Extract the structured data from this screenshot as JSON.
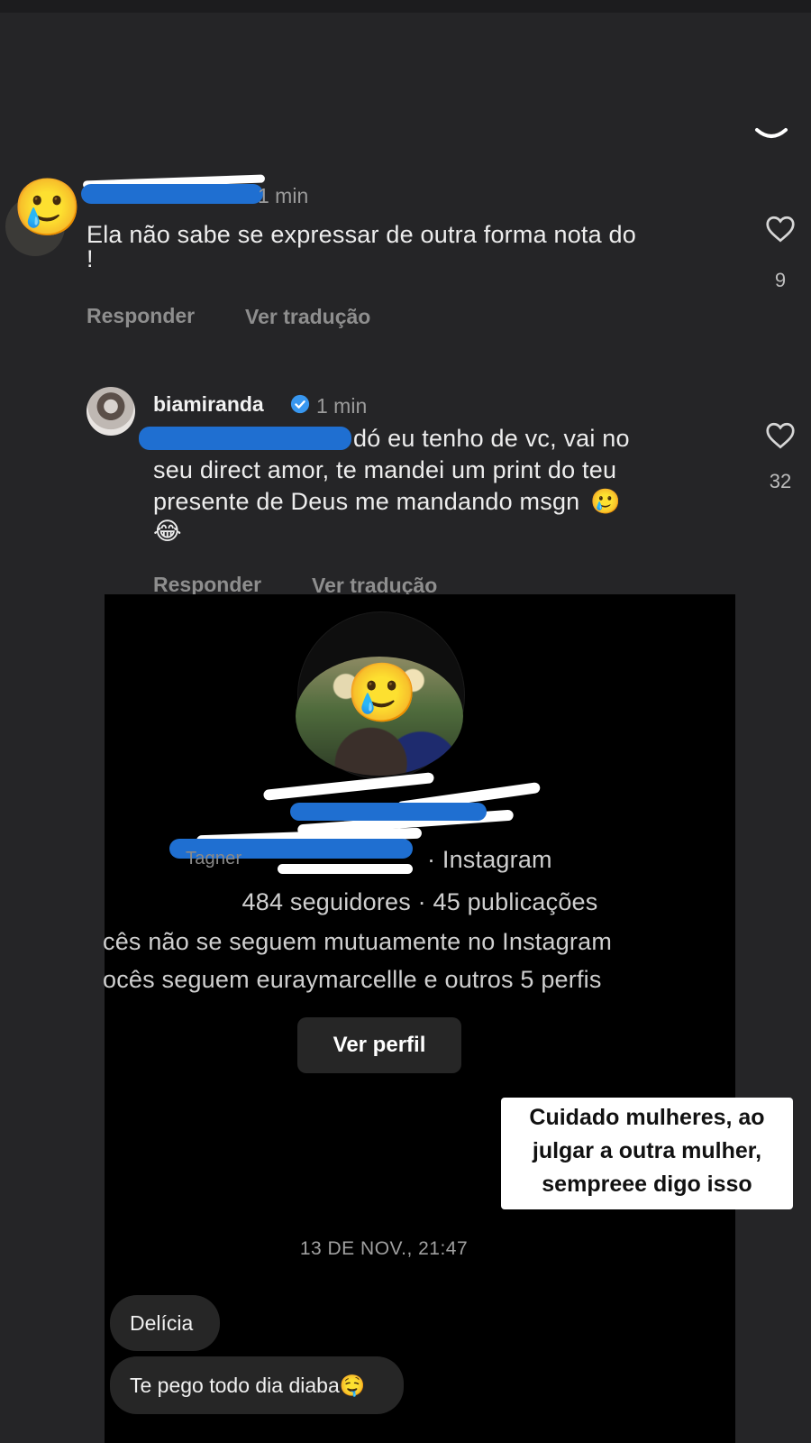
{
  "comment1": {
    "time": "1 min",
    "text_line1": "Ela não sabe se expressar de outra forma nota do",
    "text_line2": "!",
    "likes": "9",
    "reply": "Responder",
    "translate": "Ver tradução"
  },
  "comment2": {
    "username": "biamiranda",
    "time": "1 min",
    "text_line1": "dó eu tenho de vc, vai no",
    "text_line2": "seu direct amor, te mandei um print do teu",
    "text_line3": "presente de Deus me mandando msgn",
    "emoji1": "🥲",
    "emoji2": "😂",
    "likes": "32",
    "reply": "Responder",
    "translate": "Ver tradução"
  },
  "dm": {
    "instagram_line": "· Instagram",
    "partial_prefix": "Tagner",
    "stats": "484 seguidores · 45 publicações",
    "mutual_line": "cês não se seguem mutuamente no Instagram",
    "follow_line": "ocês seguem euraymarcellle e outros 5 perfis",
    "view_profile": "Ver perfil",
    "timestamp": "13 DE NOV., 21:47",
    "message1": "Delícia",
    "message2": "Te pego todo dia diaba🤤"
  },
  "sticker": {
    "line1": "Cuidado mulheres, ao",
    "line2": "julgar a outra mulher,",
    "line3": "sempreee digo isso"
  },
  "icons": {
    "emoji_sticker": "🥲",
    "heart": "heart-outline-icon",
    "chevron": "chevron-down-icon",
    "verified": "verified-badge-icon"
  }
}
